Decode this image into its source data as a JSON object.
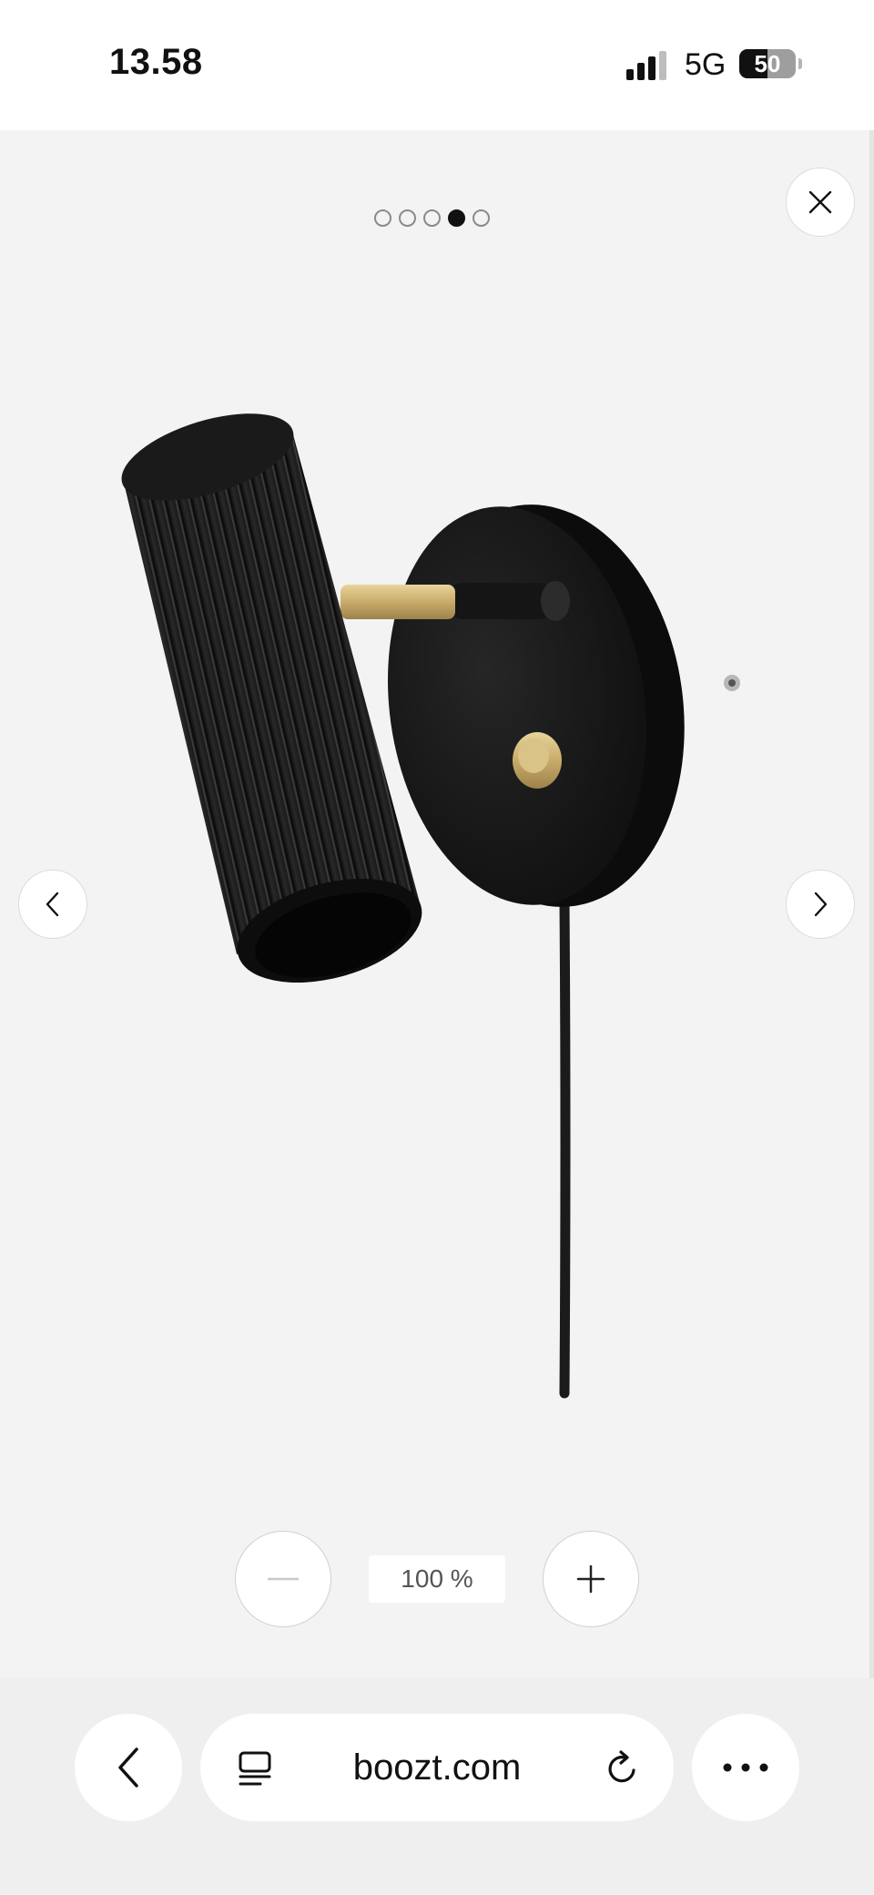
{
  "status_bar": {
    "time": "13.58",
    "network": "5G",
    "battery": "50",
    "battery_level": 0.5
  },
  "viewer": {
    "image_count": 5,
    "active_index": 3,
    "close_icon": "close-icon",
    "prev_icon": "chevron-left-icon",
    "next_icon": "chevron-right-icon",
    "zoom_level": "100 %",
    "zoom_out_icon": "minus-icon",
    "zoom_in_icon": "plus-icon"
  },
  "browser": {
    "url": "boozt.com",
    "back_icon": "chevron-left-icon",
    "tabs_icon": "tabs-icon",
    "reload_icon": "reload-icon",
    "more_icon": "ellipsis-icon"
  },
  "colors": {
    "background": "#f3f3f3",
    "lamp_body": "#1a1a1a",
    "brass": "#c9ab6b"
  }
}
